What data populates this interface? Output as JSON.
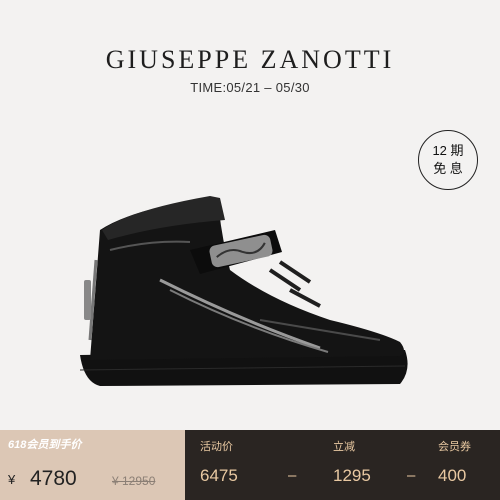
{
  "header": {
    "brand": "GIUSEPPE ZANOTTI",
    "time": "TIME:05/21 – 05/30"
  },
  "badge": {
    "line1": "12 期",
    "line2": "免 息"
  },
  "product": {
    "image_icon": "black-high-top-sneaker"
  },
  "price_bar": {
    "promo": "618会员到手价",
    "currency": "¥",
    "final_price": "4780",
    "original_price": "¥ 12950",
    "activity_label": "活动价",
    "activity_value": "6475",
    "discount_label": "立减",
    "discount_value": "1295",
    "coupon_label": "会员券",
    "coupon_value": "400",
    "separator": "–"
  },
  "colors": {
    "background": "#f3f2f1",
    "bar_left": "#dcc7b5",
    "bar_right": "#2a2522",
    "bar_text": "#e9c9a2"
  }
}
